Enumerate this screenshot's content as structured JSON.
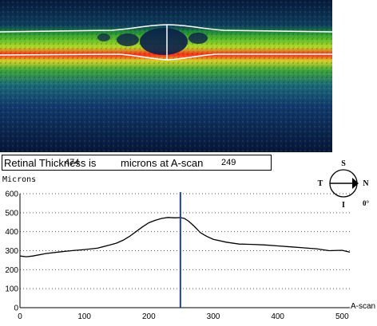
{
  "thickness": {
    "prefix": "Retinal Thickness is",
    "value": "474",
    "middle": "microns at A-scan",
    "ascan": "249"
  },
  "compass": {
    "north": "S",
    "south": "I",
    "west": "T",
    "east": "N",
    "angle": "0°"
  },
  "colors": {
    "profile_line": "#000000",
    "cursor_line": "#1f3fa8",
    "boundary_line": "#ffffff",
    "scan_background": "#05102a"
  },
  "chart_data": {
    "type": "line",
    "ylabel": "Microns",
    "xlabel": "A-scan",
    "xlim": [
      0,
      512
    ],
    "ylim": [
      0,
      600
    ],
    "xticks": [
      0,
      100,
      200,
      300,
      400,
      500
    ],
    "yticks": [
      0,
      100,
      200,
      300,
      400,
      500,
      600
    ],
    "grid": "horizontal-dotted",
    "cursor_x": 249,
    "series": [
      {
        "x": [
          0,
          10,
          20,
          40,
          60,
          80,
          100,
          120,
          140,
          150,
          160,
          170,
          180,
          190,
          200,
          210,
          220,
          230,
          240,
          249,
          255,
          262,
          270,
          280,
          290,
          300,
          320,
          340,
          360,
          380,
          400,
          420,
          440,
          460,
          480,
          500,
          512
        ],
        "values": [
          272,
          268,
          272,
          285,
          293,
          300,
          306,
          313,
          330,
          340,
          355,
          375,
          400,
          425,
          447,
          460,
          470,
          475,
          473,
          474,
          470,
          455,
          430,
          395,
          375,
          360,
          345,
          335,
          333,
          330,
          325,
          320,
          315,
          310,
          300,
          302,
          292
        ]
      }
    ]
  }
}
